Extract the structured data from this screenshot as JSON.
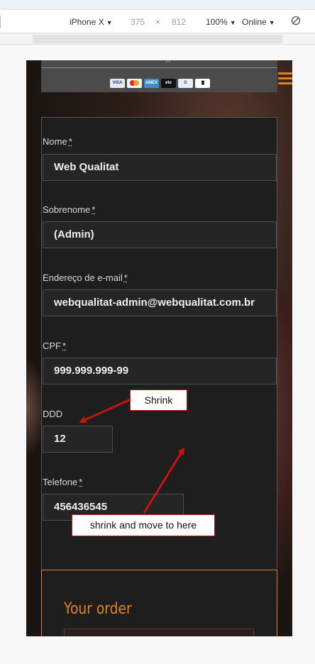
{
  "devtools": {
    "device": "iPhone X",
    "width": "375",
    "times": "×",
    "height": "812",
    "zoom": "100%",
    "network": "Online",
    "rotate_icon": "rotate-icon"
  },
  "form": {
    "first_name": {
      "label": "Nome",
      "req": "*",
      "value": "Web Qualitat"
    },
    "last_name": {
      "label": "Sobrenome",
      "req": "*",
      "value": "(Admin)"
    },
    "email": {
      "label": "Endereço de e-mail",
      "req": "*",
      "value": "webqualitat-admin@webqualitat.com.br"
    },
    "cpf": {
      "label": "CPF",
      "req": "*",
      "value": "999.999.999-99"
    },
    "ddd": {
      "label": "DDD",
      "value": "12"
    },
    "phone": {
      "label": "Telefone",
      "req": "*",
      "value": "456436545"
    }
  },
  "payment_cards": [
    "VISA",
    "MASTER",
    "AMEX",
    "elo",
    "D",
    "|||||"
  ],
  "order": {
    "title": "Your order"
  },
  "annotations": {
    "shrink": "Shrink",
    "shrink_move": "shrink and move to here"
  },
  "colors": {
    "accent": "#e67e22",
    "annotation": "#cc1111",
    "panel": "#1e1e1e"
  }
}
